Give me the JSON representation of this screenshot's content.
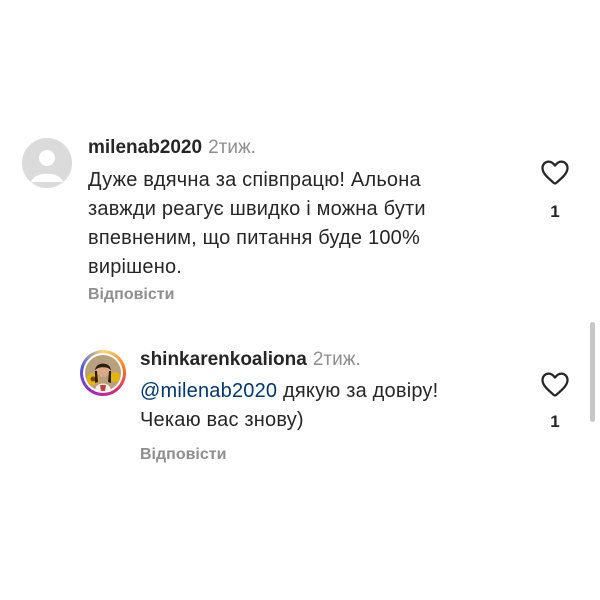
{
  "comments": [
    {
      "username": "milenab2020",
      "time": "2тиж.",
      "text": "Дуже вдячна за співпрацю! Альона завжди реагує швидко і можна бути впевненим, що питання буде 100% вирішено.",
      "lines": [
        "Дуже вдячна за співпрацю! Альона",
        "завжди реагує швидко і можна бути",
        "впевненим, що питання буде 100%",
        "вирішено."
      ],
      "reply_label": "Відповісти",
      "like_count": "1",
      "avatar": "default-avatar"
    },
    {
      "username": "shinkarenkoaliona",
      "time": "2тиж.",
      "mention": "@milenab2020",
      "text_after_mention": " дякую за довіру!",
      "line2": "Чекаю вас знову)",
      "reply_label": "Відповісти",
      "like_count": "1",
      "avatar": "profile-photo-with-story-ring"
    }
  ],
  "colors": {
    "username": "#262626",
    "secondary": "#8e8e8e",
    "mention": "#00376b",
    "avatar_placeholder": "#dbdbdb",
    "icon_stroke": "#262626"
  },
  "icons": {
    "like": "heart-outline-icon"
  }
}
